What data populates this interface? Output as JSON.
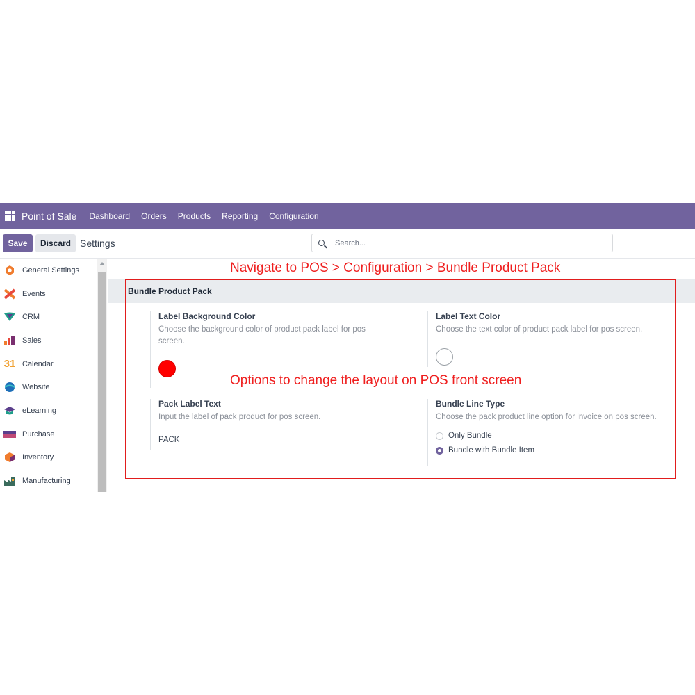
{
  "navbar": {
    "app_name": "Point of Sale",
    "menu": [
      "Dashboard",
      "Orders",
      "Products",
      "Reporting",
      "Configuration"
    ]
  },
  "control": {
    "save_label": "Save",
    "discard_label": "Discard",
    "breadcrumb": "Settings",
    "search_placeholder": "Search..."
  },
  "sidebar": {
    "items": [
      {
        "label": "General Settings",
        "icon": "general-settings-icon"
      },
      {
        "label": "Events",
        "icon": "events-icon"
      },
      {
        "label": "CRM",
        "icon": "crm-icon"
      },
      {
        "label": "Sales",
        "icon": "sales-icon"
      },
      {
        "label": "Calendar",
        "icon": "calendar-icon",
        "icon_text": "31"
      },
      {
        "label": "Website",
        "icon": "website-icon"
      },
      {
        "label": "eLearning",
        "icon": "elearning-icon"
      },
      {
        "label": "Purchase",
        "icon": "purchase-icon"
      },
      {
        "label": "Inventory",
        "icon": "inventory-icon"
      },
      {
        "label": "Manufacturing",
        "icon": "manufacturing-icon"
      }
    ]
  },
  "annotations": {
    "top": "Navigate to POS > Configuration > Bundle Product Pack",
    "middle": "Options to change the layout on POS front screen"
  },
  "section": {
    "title": "Bundle Product Pack",
    "settings": {
      "label_bg": {
        "title": "Label Background Color",
        "desc": "Choose the background color of product pack label for pos screen.",
        "color": "#ff0000"
      },
      "label_text": {
        "title": "Label Text Color",
        "desc": "Choose the text color of product pack label for pos screen.",
        "color": "#ffffff"
      },
      "pack_label": {
        "title": "Pack Label Text",
        "desc": "Input the label of pack product for pos screen.",
        "value": "PACK"
      },
      "bundle_line": {
        "title": "Bundle Line Type",
        "desc": "Choose the pack product line option for invoice on pos screen.",
        "options": [
          {
            "label": "Only Bundle",
            "checked": false
          },
          {
            "label": "Bundle with Bundle Item",
            "checked": true
          }
        ]
      }
    }
  },
  "colors": {
    "brand": "#71639e",
    "annotation": "#ef1f1f"
  }
}
